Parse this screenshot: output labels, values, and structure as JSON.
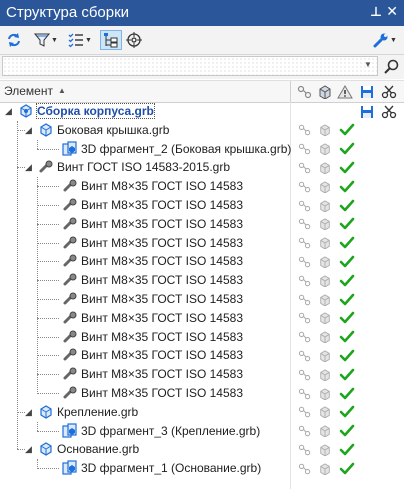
{
  "window": {
    "title": "Структура сборки"
  },
  "search": {
    "value": "",
    "placeholder": ""
  },
  "columns": {
    "element": "Элемент"
  },
  "tree": [
    {
      "label": "Сборка корпуса.grb",
      "kind": "assembly",
      "level": 0,
      "expanded": true,
      "bold": true,
      "selected": true,
      "status": "none"
    },
    {
      "label": "Боковая крышка.grb",
      "kind": "part",
      "level": 1,
      "expanded": true,
      "status": "ok"
    },
    {
      "label": "3D фрагмент_2 (Боковая крышка.grb)",
      "kind": "fragment",
      "level": 2,
      "status": "ok"
    },
    {
      "label": "Винт ГОСТ ISO 14583-2015.grb",
      "kind": "screw-group",
      "level": 1,
      "expanded": true,
      "status": "ok"
    },
    {
      "label": "Винт M8×35 ГОСТ ISO 14583",
      "kind": "screw",
      "level": 2,
      "status": "ok"
    },
    {
      "label": "Винт M8×35 ГОСТ ISO 14583",
      "kind": "screw",
      "level": 2,
      "status": "ok"
    },
    {
      "label": "Винт M8×35 ГОСТ ISO 14583",
      "kind": "screw",
      "level": 2,
      "status": "ok"
    },
    {
      "label": "Винт M8×35 ГОСТ ISO 14583",
      "kind": "screw",
      "level": 2,
      "status": "ok"
    },
    {
      "label": "Винт M8×35 ГОСТ ISO 14583",
      "kind": "screw",
      "level": 2,
      "status": "ok"
    },
    {
      "label": "Винт M8×35 ГОСТ ISO 14583",
      "kind": "screw",
      "level": 2,
      "status": "ok"
    },
    {
      "label": "Винт M8×35 ГОСТ ISO 14583",
      "kind": "screw",
      "level": 2,
      "status": "ok"
    },
    {
      "label": "Винт M8×35 ГОСТ ISO 14583",
      "kind": "screw",
      "level": 2,
      "status": "ok"
    },
    {
      "label": "Винт M8×35 ГОСТ ISO 14583",
      "kind": "screw",
      "level": 2,
      "status": "ok"
    },
    {
      "label": "Винт M8×35 ГОСТ ISO 14583",
      "kind": "screw",
      "level": 2,
      "status": "ok"
    },
    {
      "label": "Винт M8×35 ГОСТ ISO 14583",
      "kind": "screw",
      "level": 2,
      "status": "ok"
    },
    {
      "label": "Винт M8×35 ГОСТ ISO 14583",
      "kind": "screw",
      "level": 2,
      "status": "ok"
    },
    {
      "label": "Крепление.grb",
      "kind": "part",
      "level": 1,
      "expanded": true,
      "status": "ok"
    },
    {
      "label": "3D фрагмент_3 (Крепление.grb)",
      "kind": "fragment",
      "level": 2,
      "status": "ok"
    },
    {
      "label": "Основание.grb",
      "kind": "part",
      "level": 1,
      "expanded": true,
      "status": "ok"
    },
    {
      "label": "3D фрагмент_1 (Основание.grb)",
      "kind": "fragment",
      "level": 2,
      "status": "ok"
    }
  ],
  "icons": {
    "refresh": "refresh-icon",
    "filter": "filter-icon",
    "list": "list-settings-icon",
    "tree": "tree-view-icon",
    "target": "target-icon",
    "wrench": "wrench-icon",
    "search": "search-icon",
    "link": "link-icon",
    "cube": "cube-icon",
    "warning": "warning-icon",
    "save": "save-icon",
    "scissors": "scissors-icon",
    "check": "check-icon"
  },
  "colors": {
    "title_bar": "#2b579a",
    "check": "#1ea51e",
    "bold_text": "#1f4ea8",
    "accent_icon": "#1e6fd9"
  }
}
